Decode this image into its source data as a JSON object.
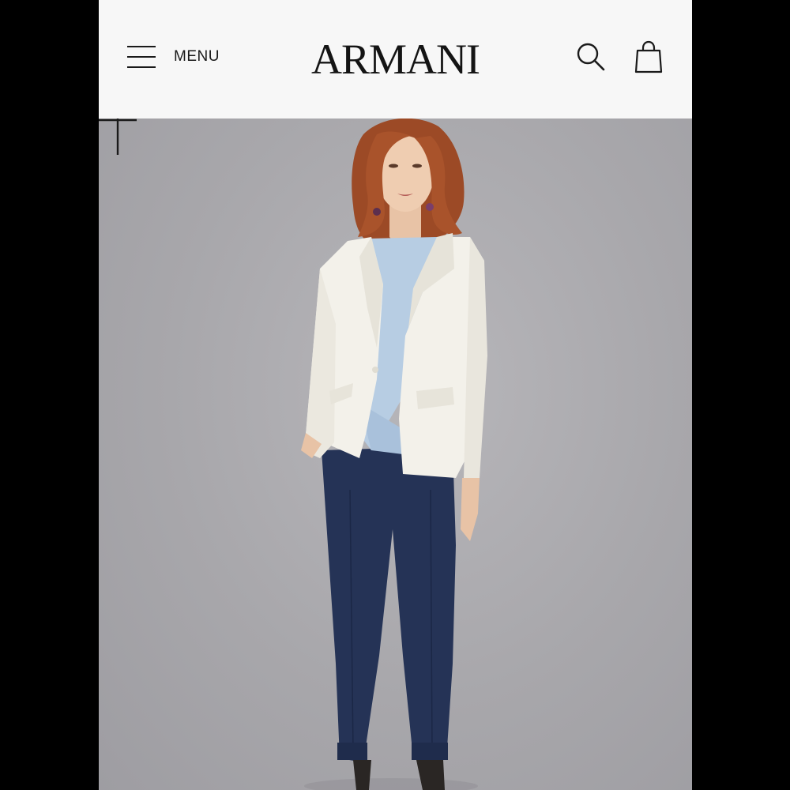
{
  "header": {
    "menu_label": "MENU",
    "logo_text": "ARMANI",
    "icons": {
      "menu": "hamburger-icon",
      "search": "search-icon",
      "bag": "shopping-bag-icon",
      "expand": "plus-icon"
    }
  },
  "product": {
    "colors": {
      "background": "#a9a8ac",
      "jacket": "#f3f1ea",
      "top": "#b7cde3",
      "trousers": "#253356",
      "hair": "#9c4a26"
    }
  }
}
